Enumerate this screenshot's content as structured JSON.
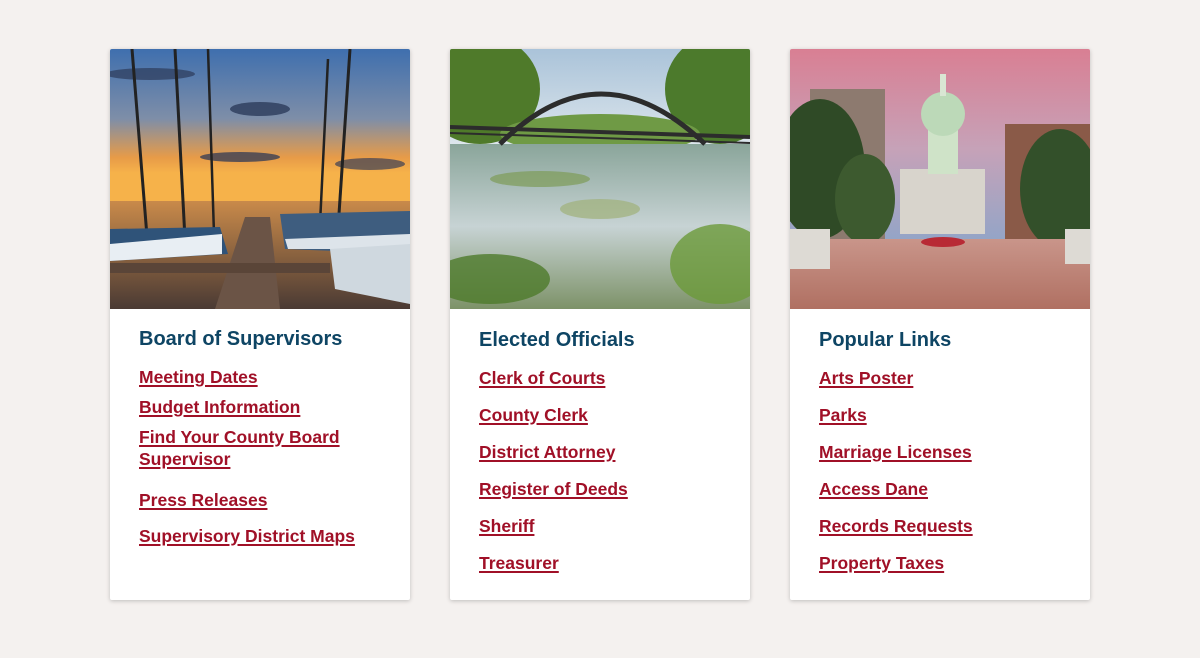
{
  "cards": [
    {
      "title": "Board of Supervisors",
      "image": "harbor-sunset-docks-photo",
      "links": [
        "Meeting Dates",
        "Budget Information",
        "Find Your County Board Supervisor",
        "Press Releases",
        "Supervisory District Maps"
      ]
    },
    {
      "title": "Elected Officials",
      "image": "park-bridge-pond-photo",
      "links": [
        "Clerk of Courts",
        "County Clerk",
        "District Attorney",
        "Register of Deeds",
        "Sheriff",
        "Treasurer"
      ]
    },
    {
      "title": "Popular Links",
      "image": "capitol-plaza-dusk-photo",
      "links": [
        "Arts Poster",
        "Parks",
        "Marriage Licenses",
        "Access Dane",
        "Records Requests",
        "Property Taxes"
      ]
    }
  ],
  "colors": {
    "page_background": "#f4f1ef",
    "title": "#0e4564",
    "link": "#a01027"
  }
}
